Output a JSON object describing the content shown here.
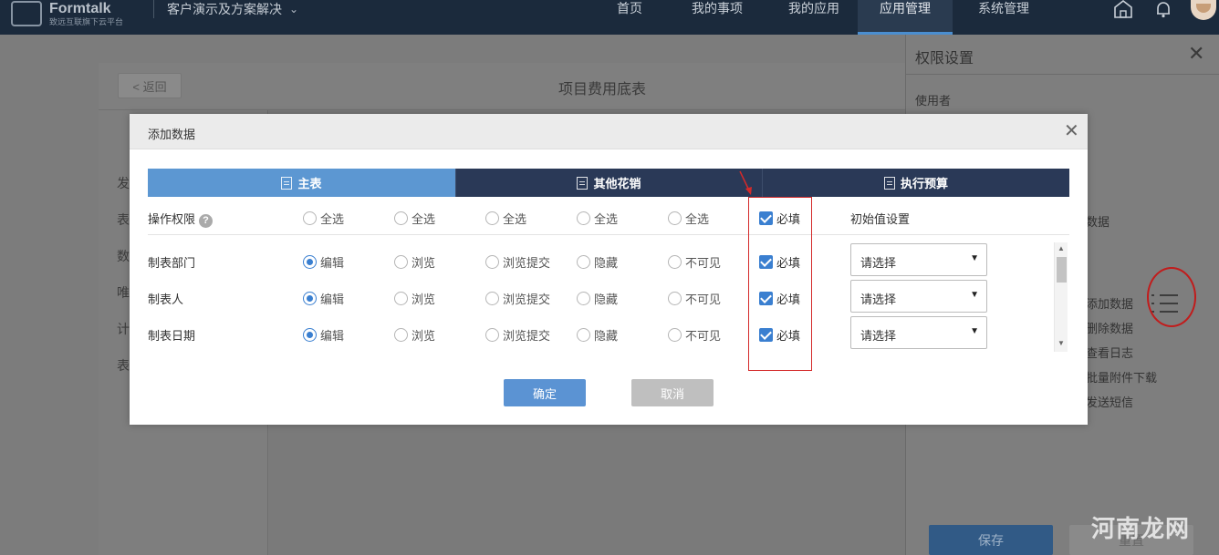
{
  "app": {
    "logo_title": "Formtalk",
    "logo_subtitle": "致远互联旗下云平台",
    "org_name": "客户演示及方案解决",
    "nav": [
      "首页",
      "我的事项",
      "我的应用",
      "应用管理",
      "系统管理"
    ],
    "active_nav": "应用管理"
  },
  "background_page": {
    "back_label": "< 返回",
    "title": "项目费用底表",
    "side_items": [
      "发",
      "表",
      "数",
      "唯",
      "计",
      "表"
    ]
  },
  "right_panel": {
    "title": "权限设置",
    "user_label": "使用者",
    "frag_data": "数据",
    "actions": [
      "添加数据",
      "删除数据",
      "查看日志",
      "批量附件下载",
      "发送短信"
    ],
    "save_label": "保存",
    "reset_label": "重置"
  },
  "watermark": "河南龙网",
  "modal": {
    "title": "添加数据",
    "tabs": [
      "主表",
      "其他花销",
      "执行预算"
    ],
    "active_tab": "主表",
    "header_row": {
      "label": "操作权限",
      "help": "?",
      "select_all": [
        "全选",
        "全选",
        "全选",
        "全选",
        "全选"
      ],
      "required": "必填",
      "init_value_label": "初始值设置"
    },
    "rows": [
      {
        "field": "制表部门",
        "options": [
          "编辑",
          "浏览",
          "浏览提交",
          "隐藏",
          "不可见"
        ],
        "selected": "编辑",
        "required": "必填",
        "select_value": "请选择"
      },
      {
        "field": "制表人",
        "options": [
          "编辑",
          "浏览",
          "浏览提交",
          "隐藏",
          "不可见"
        ],
        "selected": "编辑",
        "required": "必填",
        "select_value": "请选择"
      },
      {
        "field": "制表日期",
        "options": [
          "编辑",
          "浏览",
          "浏览提交",
          "隐藏",
          "不可见"
        ],
        "selected": "编辑",
        "required": "必填",
        "select_value": "请选择"
      }
    ],
    "ok_label": "确定",
    "cancel_label": "取消"
  },
  "colors": {
    "tab_active": "#5c97d2",
    "tab_inactive": "#2a3957",
    "primary": "#5b93d3",
    "annotation_red": "#d42a2a"
  }
}
